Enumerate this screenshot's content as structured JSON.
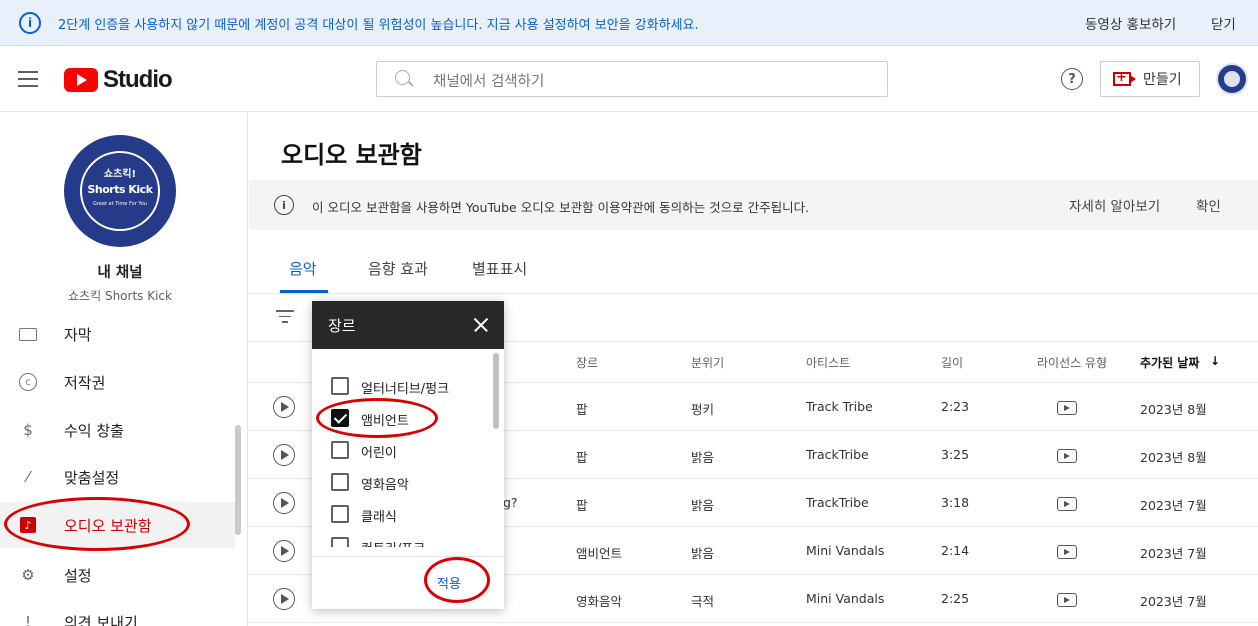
{
  "banner": {
    "message": "2단계 인증을 사용하지 않기 때문에 계정이 공격 대상이 될 위험성이 높습니다. 지금 사용 설정하여 보안을 강화하세요.",
    "promote": "동영상 홍보하기",
    "close": "닫기"
  },
  "header": {
    "logo_text": "Studio",
    "search_placeholder": "채널에서 검색하기",
    "create_label": "만들기"
  },
  "sidebar": {
    "channel_title": "내 채널",
    "channel_name": "쇼츠킥 Shorts Kick",
    "avatar_text": [
      "쇼츠킥!",
      "Shorts Kick",
      "Great at Time For You"
    ],
    "items": [
      {
        "label": "자막",
        "icon": "subtitles-icon"
      },
      {
        "label": "저작권",
        "icon": "copyright-icon"
      },
      {
        "label": "수익 창출",
        "icon": "dollar-icon"
      },
      {
        "label": "맞춤설정",
        "icon": "magic-wand-icon"
      },
      {
        "label": "오디오 보관함",
        "icon": "audio-library-icon",
        "active": true
      },
      {
        "label": "설정",
        "icon": "gear-icon"
      },
      {
        "label": "의견 보내기",
        "icon": "feedback-icon"
      }
    ]
  },
  "main": {
    "title": "오디오 보관함",
    "notice": {
      "text": "이 오디오 보관함을 사용하면 YouTube 오디오 보관함 이용약관에 동의하는 것으로 간주됩니다.",
      "learn_more": "자세히 알아보기",
      "confirm": "확인"
    },
    "tabs": [
      "음악",
      "음향 효과",
      "별표표시"
    ],
    "columns": {
      "genre": "장르",
      "mood": "분위기",
      "artist": "아티스트",
      "length": "길이",
      "license": "라이선스 유형",
      "added": "추가된 날짜",
      "sort_arrow": "↓"
    },
    "rows": [
      {
        "title_tail": "",
        "genre": "팝",
        "mood": "펑키",
        "artist": "Track Tribe",
        "length": "2:23",
        "added": "2023년 8월"
      },
      {
        "title_tail": "",
        "genre": "팝",
        "mood": "밝음",
        "artist": "TrackTribe",
        "length": "3:25",
        "added": "2023년 8월"
      },
      {
        "title_tail": "g?",
        "genre": "팝",
        "mood": "밝음",
        "artist": "TrackTribe",
        "length": "3:18",
        "added": "2023년 7월"
      },
      {
        "title_tail": "",
        "genre": "앰비언트",
        "mood": "밝음",
        "artist": "Mini Vandals",
        "length": "2:14",
        "added": "2023년 7월"
      },
      {
        "title_tail": "",
        "genre": "영화음악",
        "mood": "극적",
        "artist": "Mini Vandals",
        "length": "2:25",
        "added": "2023년 7월"
      }
    ]
  },
  "genre_popup": {
    "title": "장르",
    "options": [
      {
        "label": "얼터너티브/펑크",
        "checked": false
      },
      {
        "label": "앰비언트",
        "checked": true
      },
      {
        "label": "어린이",
        "checked": false
      },
      {
        "label": "영화음악",
        "checked": false
      },
      {
        "label": "클래식",
        "checked": false
      },
      {
        "label": "컨트리/포크",
        "checked": false
      }
    ],
    "apply": "적용"
  },
  "colors": {
    "accent_blue": "#065fd4",
    "brand_red": "#ff0000",
    "highlight_ring": "#d90000",
    "banner_bg": "#e8f0fb"
  }
}
